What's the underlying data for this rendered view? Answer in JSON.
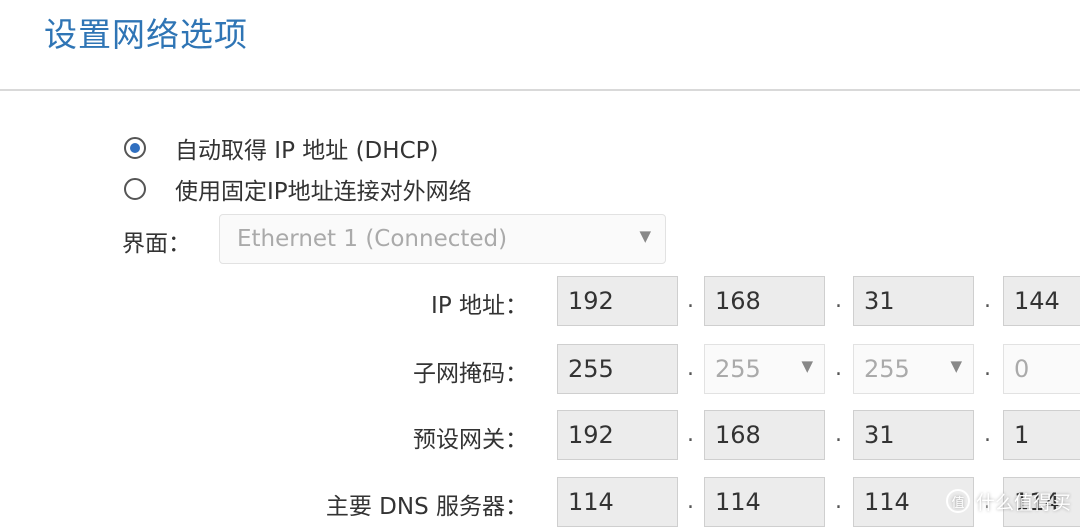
{
  "page": {
    "title": "设置网络选项"
  },
  "mode": {
    "selected": "dhcp",
    "options": [
      {
        "id": "dhcp",
        "label": "自动取得 IP 地址 (DHCP)"
      },
      {
        "id": "static",
        "label": "使用固定IP地址连接对外网络"
      }
    ]
  },
  "interface": {
    "label": "界面：",
    "value": "Ethernet 1 (Connected)"
  },
  "fields": {
    "ip": {
      "label": "IP 地址：",
      "octets": [
        "192",
        "168",
        "31",
        "144"
      ]
    },
    "subnet": {
      "label": "子网掩码：",
      "octets": [
        "255",
        "255",
        "255",
        "0"
      ]
    },
    "gateway": {
      "label": "预设网关：",
      "octets": [
        "192",
        "168",
        "31",
        "1"
      ]
    },
    "dns": {
      "label": "主要 DNS 服务器：",
      "octets": [
        "114",
        "114",
        "114",
        "114"
      ]
    }
  },
  "separator": ".",
  "watermark": {
    "text": "什么值得买",
    "icon": "zhi-logo-icon"
  },
  "colors": {
    "title": "#2f75b5",
    "radio_selected": "#2f6fc0"
  }
}
